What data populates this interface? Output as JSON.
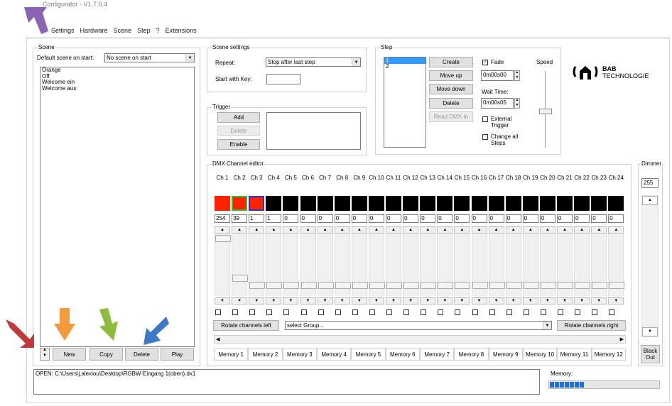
{
  "window": {
    "title": "Configurator - V1.7.0.4"
  },
  "menu": [
    "Settings",
    "Hardware",
    "Scene",
    "Step",
    "?",
    "Extensions"
  ],
  "scene": {
    "group_label": "Scene",
    "default_label": "Default scene on start:",
    "default_value": "No scene on start",
    "items": [
      "Orange",
      "Off",
      "Welcome ein",
      "Welcome aus"
    ],
    "buttons": {
      "new": "New",
      "copy": "Copy",
      "delete": "Delete",
      "play": "Play"
    }
  },
  "scene_settings": {
    "group_label": "Scene settings",
    "repeat_label": "Repeat:",
    "repeat_value": "Stop after last step",
    "start_key_label": "Start with Key:",
    "start_key_value": ""
  },
  "trigger": {
    "group_label": "Trigger",
    "add": "Add",
    "delete": "Delete",
    "enable": "Enable"
  },
  "step": {
    "group_label": "Step",
    "items": [
      "1",
      "2"
    ],
    "create": "Create",
    "move_up": "Move up",
    "move_down": "Move down",
    "delete": "Delete",
    "read_dmx": "Read DMX-In",
    "fade_label": "Fade",
    "fade_value": "0m00s00",
    "wait_label": "Wait Time:",
    "wait_value": "0m00s05",
    "external_trigger": "External Trigger",
    "change_all": "Change all Steps",
    "speed_label": "Speed"
  },
  "logo": {
    "line1": "BAB",
    "line2": "TECHNOLOGIE"
  },
  "dmx": {
    "group_label": "DMX Channel editor",
    "channels": [
      {
        "label": "Ch 1",
        "value": "254",
        "color": "#ff2200"
      },
      {
        "label": "Ch 2",
        "value": "39",
        "color": "#ff2200"
      },
      {
        "label": "Ch 3",
        "value": "1",
        "color": "#ff2200"
      },
      {
        "label": "Ch 4",
        "value": "1",
        "color": "#000000"
      },
      {
        "label": "Ch 5",
        "value": "0",
        "color": "#000000"
      },
      {
        "label": "Ch 6",
        "value": "0",
        "color": "#000000"
      },
      {
        "label": "Ch 7",
        "value": "0",
        "color": "#000000"
      },
      {
        "label": "Ch 8",
        "value": "0",
        "color": "#000000"
      },
      {
        "label": "Ch 9",
        "value": "0",
        "color": "#000000"
      },
      {
        "label": "Ch 10",
        "value": "0",
        "color": "#000000"
      },
      {
        "label": "Ch 11",
        "value": "0",
        "color": "#000000"
      },
      {
        "label": "Ch 12",
        "value": "0",
        "color": "#000000"
      },
      {
        "label": "Ch 13",
        "value": "0",
        "color": "#000000"
      },
      {
        "label": "Ch 14",
        "value": "0",
        "color": "#000000"
      },
      {
        "label": "Ch 15",
        "value": "0",
        "color": "#000000"
      },
      {
        "label": "Ch 16",
        "value": "0",
        "color": "#000000"
      },
      {
        "label": "Ch 17",
        "value": "0",
        "color": "#000000"
      },
      {
        "label": "Ch 18",
        "value": "0",
        "color": "#000000"
      },
      {
        "label": "Ch 19",
        "value": "0",
        "color": "#000000"
      },
      {
        "label": "Ch 20",
        "value": "0",
        "color": "#000000"
      },
      {
        "label": "Ch 21",
        "value": "0",
        "color": "#000000"
      },
      {
        "label": "Ch 22",
        "value": "0",
        "color": "#000000"
      },
      {
        "label": "Ch 23",
        "value": "0",
        "color": "#000000"
      },
      {
        "label": "Ch 24",
        "value": "0",
        "color": "#000000"
      }
    ],
    "rotate_left": "Rotate channels left",
    "group_select": "select Group...",
    "rotate_right": "Rotate cbannels right",
    "memories": [
      "Memory 1",
      "Memory 2",
      "Memory 3",
      "Memory 4",
      "Memory 5",
      "Memory 6",
      "Memory 7",
      "Memory 8",
      "Memory 9",
      "Memory 10",
      "Memory 11",
      "Memory 12"
    ]
  },
  "dimmer": {
    "label": "Dimmer",
    "value": "255",
    "blackout": "Black Out"
  },
  "status": {
    "text": "OPEN: C:\\Users\\j.alexiou\\Desktop\\RGBW-Eingang 1(oben).dx1",
    "memory_label": "Memory:",
    "memory_blocks": 7
  },
  "annotation_colors": {
    "purple": "#8b63b5",
    "red": "#c0393b",
    "orange": "#f39a3c",
    "green": "#8dbb3e",
    "blue": "#3f78c7"
  }
}
